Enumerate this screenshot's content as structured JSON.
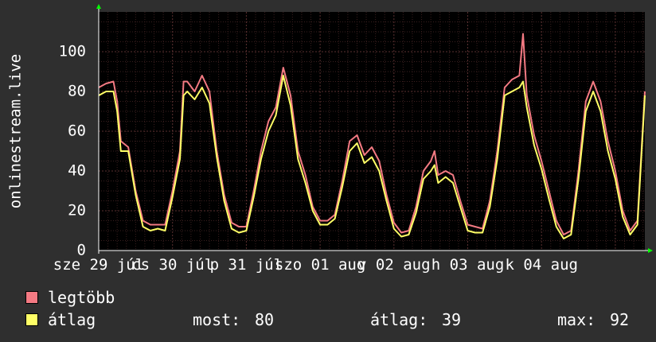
{
  "chart_data": {
    "type": "line",
    "ylabel": "onlinestream.live",
    "ylim": [
      0,
      120
    ],
    "yticks": [
      0,
      20,
      40,
      60,
      80,
      100
    ],
    "x_tick_labels": [
      "sze 29 júl",
      "cs 30 júl",
      "p 31 júl",
      "szo 01 aug",
      "v 02 aug",
      "h 03 aug",
      "k 04 aug"
    ],
    "x_range": [
      0,
      7.4
    ],
    "grid": true,
    "series": [
      {
        "name": "legtöbb",
        "color": "#f47a83",
        "points": [
          [
            0.0,
            82
          ],
          [
            0.1,
            84
          ],
          [
            0.2,
            85
          ],
          [
            0.25,
            75
          ],
          [
            0.3,
            55
          ],
          [
            0.4,
            52
          ],
          [
            0.5,
            30
          ],
          [
            0.6,
            15
          ],
          [
            0.7,
            13
          ],
          [
            0.8,
            13
          ],
          [
            0.9,
            13
          ],
          [
            1.0,
            30
          ],
          [
            1.1,
            50
          ],
          [
            1.15,
            85
          ],
          [
            1.2,
            85
          ],
          [
            1.3,
            80
          ],
          [
            1.4,
            88
          ],
          [
            1.5,
            80
          ],
          [
            1.6,
            50
          ],
          [
            1.7,
            28
          ],
          [
            1.8,
            14
          ],
          [
            1.9,
            12
          ],
          [
            2.0,
            12
          ],
          [
            2.1,
            30
          ],
          [
            2.2,
            50
          ],
          [
            2.3,
            65
          ],
          [
            2.4,
            72
          ],
          [
            2.5,
            92
          ],
          [
            2.6,
            78
          ],
          [
            2.7,
            50
          ],
          [
            2.8,
            38
          ],
          [
            2.9,
            22
          ],
          [
            3.0,
            15
          ],
          [
            3.1,
            15
          ],
          [
            3.2,
            18
          ],
          [
            3.3,
            35
          ],
          [
            3.4,
            55
          ],
          [
            3.5,
            58
          ],
          [
            3.6,
            48
          ],
          [
            3.7,
            52
          ],
          [
            3.8,
            45
          ],
          [
            3.9,
            28
          ],
          [
            4.0,
            14
          ],
          [
            4.1,
            9
          ],
          [
            4.2,
            10
          ],
          [
            4.3,
            22
          ],
          [
            4.4,
            40
          ],
          [
            4.5,
            45
          ],
          [
            4.55,
            50
          ],
          [
            4.6,
            38
          ],
          [
            4.7,
            40
          ],
          [
            4.8,
            38
          ],
          [
            4.9,
            25
          ],
          [
            5.0,
            13
          ],
          [
            5.1,
            12
          ],
          [
            5.2,
            11
          ],
          [
            5.3,
            25
          ],
          [
            5.4,
            50
          ],
          [
            5.5,
            82
          ],
          [
            5.6,
            86
          ],
          [
            5.7,
            88
          ],
          [
            5.75,
            109
          ],
          [
            5.8,
            78
          ],
          [
            5.9,
            58
          ],
          [
            6.0,
            45
          ],
          [
            6.1,
            30
          ],
          [
            6.2,
            15
          ],
          [
            6.3,
            8
          ],
          [
            6.4,
            10
          ],
          [
            6.5,
            40
          ],
          [
            6.6,
            75
          ],
          [
            6.7,
            85
          ],
          [
            6.8,
            75
          ],
          [
            6.9,
            55
          ],
          [
            7.0,
            40
          ],
          [
            7.1,
            20
          ],
          [
            7.2,
            10
          ],
          [
            7.3,
            15
          ],
          [
            7.4,
            80
          ]
        ]
      },
      {
        "name": "átlag",
        "color": "#ffff66",
        "points": [
          [
            0.0,
            78
          ],
          [
            0.1,
            80
          ],
          [
            0.2,
            80
          ],
          [
            0.25,
            70
          ],
          [
            0.3,
            50
          ],
          [
            0.4,
            50
          ],
          [
            0.5,
            28
          ],
          [
            0.6,
            12
          ],
          [
            0.7,
            10
          ],
          [
            0.8,
            11
          ],
          [
            0.9,
            10
          ],
          [
            1.0,
            27
          ],
          [
            1.1,
            46
          ],
          [
            1.15,
            78
          ],
          [
            1.2,
            80
          ],
          [
            1.3,
            76
          ],
          [
            1.4,
            82
          ],
          [
            1.5,
            74
          ],
          [
            1.6,
            47
          ],
          [
            1.7,
            25
          ],
          [
            1.8,
            11
          ],
          [
            1.9,
            9
          ],
          [
            2.0,
            10
          ],
          [
            2.1,
            27
          ],
          [
            2.2,
            46
          ],
          [
            2.3,
            60
          ],
          [
            2.4,
            68
          ],
          [
            2.5,
            88
          ],
          [
            2.6,
            73
          ],
          [
            2.7,
            46
          ],
          [
            2.8,
            34
          ],
          [
            2.9,
            20
          ],
          [
            3.0,
            13
          ],
          [
            3.1,
            13
          ],
          [
            3.2,
            16
          ],
          [
            3.3,
            32
          ],
          [
            3.4,
            50
          ],
          [
            3.5,
            54
          ],
          [
            3.6,
            44
          ],
          [
            3.7,
            47
          ],
          [
            3.8,
            40
          ],
          [
            3.9,
            25
          ],
          [
            4.0,
            11
          ],
          [
            4.1,
            7
          ],
          [
            4.2,
            8
          ],
          [
            4.3,
            19
          ],
          [
            4.4,
            36
          ],
          [
            4.5,
            40
          ],
          [
            4.55,
            43
          ],
          [
            4.6,
            34
          ],
          [
            4.7,
            37
          ],
          [
            4.8,
            34
          ],
          [
            4.9,
            22
          ],
          [
            5.0,
            10
          ],
          [
            5.1,
            9
          ],
          [
            5.2,
            9
          ],
          [
            5.3,
            22
          ],
          [
            5.4,
            46
          ],
          [
            5.5,
            78
          ],
          [
            5.6,
            80
          ],
          [
            5.7,
            82
          ],
          [
            5.75,
            85
          ],
          [
            5.8,
            72
          ],
          [
            5.9,
            53
          ],
          [
            6.0,
            41
          ],
          [
            6.1,
            26
          ],
          [
            6.2,
            12
          ],
          [
            6.3,
            6
          ],
          [
            6.4,
            8
          ],
          [
            6.5,
            36
          ],
          [
            6.6,
            70
          ],
          [
            6.7,
            80
          ],
          [
            6.8,
            70
          ],
          [
            6.9,
            50
          ],
          [
            7.0,
            36
          ],
          [
            7.1,
            17
          ],
          [
            7.2,
            8
          ],
          [
            7.3,
            13
          ],
          [
            7.4,
            78
          ]
        ]
      }
    ],
    "stats": {
      "most_label": "most:",
      "most_value": "80",
      "atlag_label": "átlag:",
      "atlag_value": "39",
      "max_label": "max:",
      "max_value": "92"
    }
  },
  "colors": {
    "background": "#2f2f2f",
    "plot_background": "#000000",
    "grid_minor": "#3a1f1f",
    "grid_major": "#5a3030",
    "axis": "#ffffff",
    "arrow": "#00ff00"
  }
}
